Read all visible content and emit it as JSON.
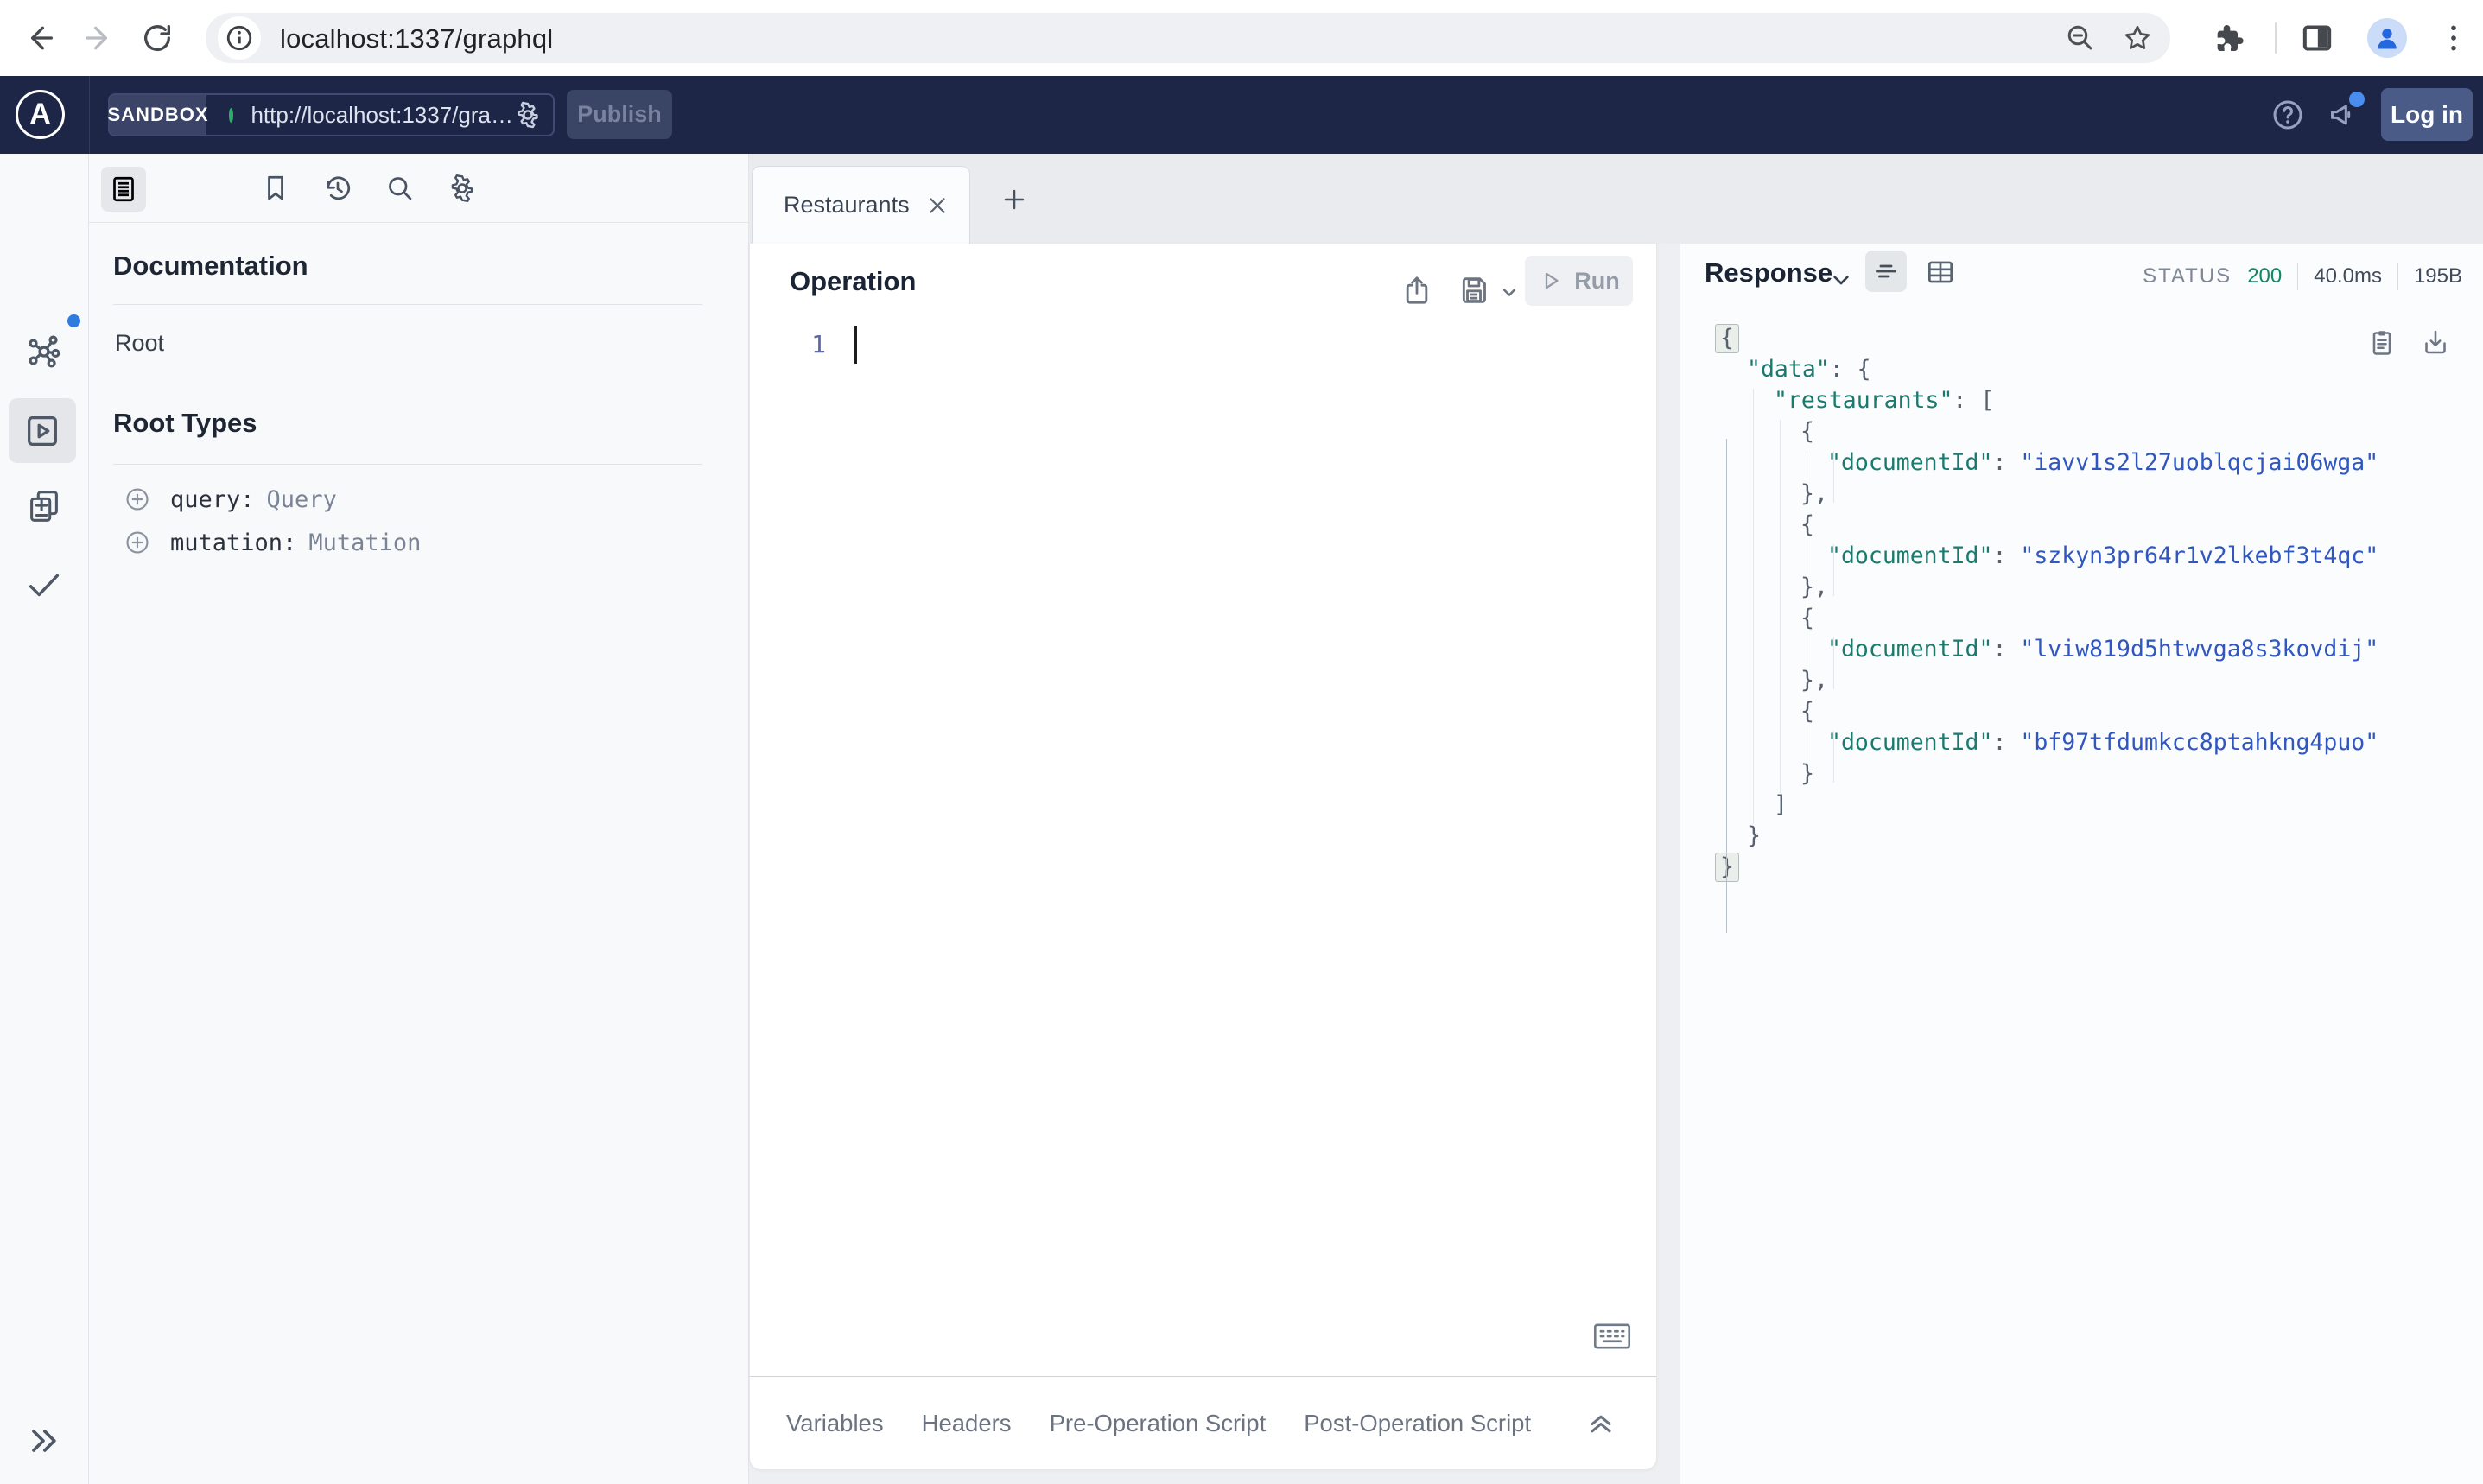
{
  "browser": {
    "url": "localhost:1337/graphql"
  },
  "header": {
    "logo_letter": "A",
    "env_label": "SANDBOX",
    "endpoint": "http://localhost:1337/gra…",
    "publish_label": "Publish",
    "login_label": "Log in"
  },
  "docs": {
    "title": "Documentation",
    "root_link": "Root",
    "root_types_title": "Root Types",
    "root_types": [
      {
        "name": "query:",
        "type": "Query"
      },
      {
        "name": "mutation:",
        "type": "Mutation"
      }
    ]
  },
  "tabs": {
    "active": "Restaurants"
  },
  "operation": {
    "title": "Operation",
    "run_label": "Run",
    "line_number": "1"
  },
  "response": {
    "title": "Response",
    "status_label": "STATUS",
    "status_code": "200",
    "time": "40.0ms",
    "size": "195B",
    "json_lines": [
      {
        "i": 0,
        "b": true,
        "s": [
          [
            "p",
            "{"
          ]
        ]
      },
      {
        "i": 1,
        "s": [
          [
            "k",
            "\"data\""
          ],
          [
            "p",
            ": {"
          ]
        ]
      },
      {
        "i": 2,
        "s": [
          [
            "k",
            "\"restaurants\""
          ],
          [
            "p",
            ": ["
          ]
        ]
      },
      {
        "i": 3,
        "s": [
          [
            "p",
            "{"
          ]
        ]
      },
      {
        "i": 4,
        "s": [
          [
            "k",
            "\"documentId\""
          ],
          [
            "p",
            ": "
          ],
          [
            "v",
            "\"iavv1s2l27uoblqcjai06wga\""
          ]
        ]
      },
      {
        "i": 3,
        "s": [
          [
            "p",
            "},"
          ]
        ]
      },
      {
        "i": 3,
        "s": [
          [
            "p",
            "{"
          ]
        ]
      },
      {
        "i": 4,
        "s": [
          [
            "k",
            "\"documentId\""
          ],
          [
            "p",
            ": "
          ],
          [
            "v",
            "\"szkyn3pr64r1v2lkebf3t4qc\""
          ]
        ]
      },
      {
        "i": 3,
        "s": [
          [
            "p",
            "},"
          ]
        ]
      },
      {
        "i": 3,
        "s": [
          [
            "p",
            "{"
          ]
        ]
      },
      {
        "i": 4,
        "s": [
          [
            "k",
            "\"documentId\""
          ],
          [
            "p",
            ": "
          ],
          [
            "v",
            "\"lviw819d5htwvga8s3kovdij\""
          ]
        ]
      },
      {
        "i": 3,
        "s": [
          [
            "p",
            "},"
          ]
        ]
      },
      {
        "i": 3,
        "s": [
          [
            "p",
            "{"
          ]
        ]
      },
      {
        "i": 4,
        "s": [
          [
            "k",
            "\"documentId\""
          ],
          [
            "p",
            ": "
          ],
          [
            "v",
            "\"bf97tfdumkcc8ptahkng4puo\""
          ]
        ]
      },
      {
        "i": 3,
        "s": [
          [
            "p",
            "}"
          ]
        ]
      },
      {
        "i": 2,
        "s": [
          [
            "p",
            "]"
          ]
        ]
      },
      {
        "i": 1,
        "s": [
          [
            "p",
            "}"
          ]
        ]
      },
      {
        "i": 0,
        "b": true,
        "s": [
          [
            "p",
            "}"
          ]
        ]
      }
    ]
  },
  "bottom_tabs": [
    "Variables",
    "Headers",
    "Pre-Operation Script",
    "Post-Operation Script"
  ],
  "colors": {
    "apollo_navy": "#1d2646",
    "status_green": "#0e8a63",
    "endpoint_dot_green": "#2fae68",
    "notification_blue": "#4a8df0",
    "json_key_teal": "#1b7a6e",
    "json_value_blue": "#3057c0"
  }
}
